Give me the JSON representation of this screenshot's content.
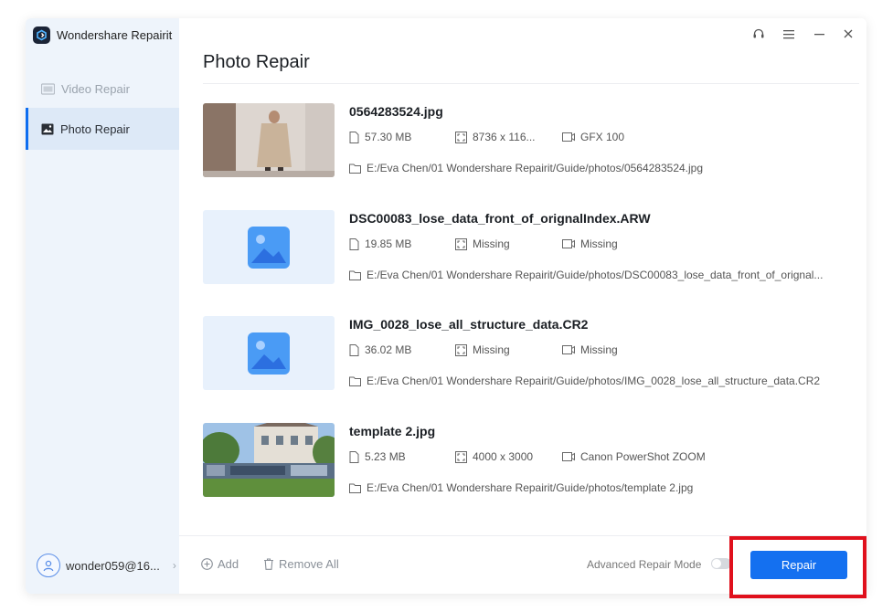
{
  "app": {
    "name": "Wondershare Repairit"
  },
  "sidebar": {
    "items": [
      {
        "label": "Video Repair",
        "icon": "video-icon",
        "active": false
      },
      {
        "label": "Photo Repair",
        "icon": "photo-icon",
        "active": true
      }
    ],
    "user": {
      "name": "wonder059@16...",
      "chevron": "›"
    }
  },
  "main": {
    "title": "Photo Repair",
    "files": [
      {
        "name": "0564283524.jpg",
        "size": "57.30 MB",
        "resolution": "8736 x 116...",
        "camera": "GFX 100",
        "path": "E:/Eva Chen/01 Wondershare Repairit/Guide/photos/0564283524.jpg",
        "thumb": "person-photo"
      },
      {
        "name": "DSC00083_lose_data_front_of_orignalIndex.ARW",
        "size": "19.85 MB",
        "resolution": "Missing",
        "camera": "Missing",
        "path": "E:/Eva Chen/01 Wondershare Repairit/Guide/photos/DSC00083_lose_data_front_of_orignal...",
        "thumb": "placeholder"
      },
      {
        "name": "IMG_0028_lose_all_structure_data.CR2",
        "size": "36.02 MB",
        "resolution": "Missing",
        "camera": "Missing",
        "path": "E:/Eva Chen/01 Wondershare Repairit/Guide/photos/IMG_0028_lose_all_structure_data.CR2",
        "thumb": "placeholder"
      },
      {
        "name": "template 2.jpg",
        "size": "5.23 MB",
        "resolution": "4000 x 3000",
        "camera": "Canon PowerShot ZOOM",
        "path": "E:/Eva Chen/01 Wondershare Repairit/Guide/photos/template 2.jpg",
        "thumb": "street-photo"
      }
    ]
  },
  "footer": {
    "add_label": "Add",
    "remove_all_label": "Remove All",
    "advanced_label": "Advanced Repair Mode",
    "advanced_enabled": false,
    "repair_label": "Repair"
  },
  "colors": {
    "accent": "#1470f0",
    "highlight": "#e0101c",
    "sidebar_bg": "#eef4fb"
  }
}
